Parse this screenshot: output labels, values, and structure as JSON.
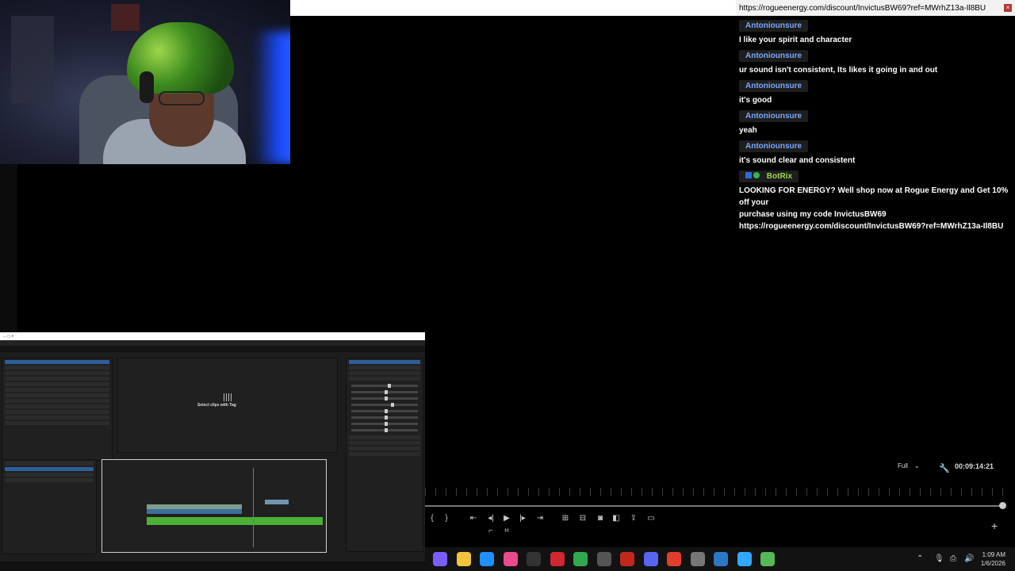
{
  "chat": {
    "url_bar_text": "https://rogueenergy.com/discount/InvictusBW69?ref=MWrhZ13a-Il8BU",
    "messages": [
      {
        "user": "Antoniounsure",
        "text": "I like your spirit and character"
      },
      {
        "user": "Antoniounsure",
        "text": "ur sound isn't consistent, Its likes it going in and out"
      },
      {
        "user": "Antoniounsure",
        "text": "it's good"
      },
      {
        "user": "Antoniounsure",
        "text": "yeah"
      },
      {
        "user": "Antoniounsure",
        "text": "it's sound clear and consistent"
      }
    ],
    "bot": {
      "user": "BotRix",
      "line1": "LOOKING FOR ENERGY? Well shop now at Rogue Energy and Get 10% off your",
      "line2": "purchase using my code InvictusBW69",
      "line3": "https://rogueenergy.com/discount/InvictusBW69?ref=MWrhZ13a-Il8BU"
    }
  },
  "premiere": {
    "select_clips_text": "Select clips with Tag"
  },
  "player": {
    "quality": "Full",
    "timecode": "00:09:14:21"
  },
  "taskbar": {
    "time": "1:09 AM",
    "date": "1/6/2026",
    "icon_colors": [
      "#7b5cff",
      "#f3c33b",
      "#1e90ff",
      "#e94b8c",
      "#333333",
      "#d22630",
      "#2fa84f",
      "#555555",
      "#c2271c",
      "#5865f2",
      "#e23d2a",
      "#777777",
      "#2b78c5",
      "#31a8ff",
      "#56b856"
    ]
  }
}
